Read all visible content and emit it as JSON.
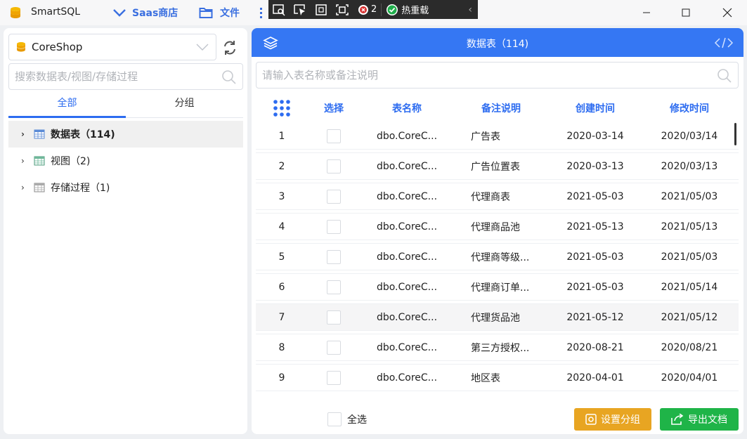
{
  "window": {
    "app_title": "SmartSQL",
    "menu": [
      {
        "label": "Saas商店"
      },
      {
        "label": "文件"
      }
    ]
  },
  "devtools": {
    "error_count": "2",
    "hot_reload_label": "热重载"
  },
  "left": {
    "database": "CoreShop",
    "search_placeholder": "搜索数据表/视图/存储过程",
    "tabs": [
      {
        "label": "全部",
        "active": true
      },
      {
        "label": "分组",
        "active": false
      }
    ],
    "tree": [
      {
        "label": "数据表（114)",
        "icon": "table-icon",
        "selected": true
      },
      {
        "label": "视图（2)",
        "icon": "view-icon",
        "selected": false
      },
      {
        "label": "存储过程（1)",
        "icon": "procedure-icon",
        "selected": false
      }
    ]
  },
  "right": {
    "title": "数据表（114)",
    "search_placeholder": "请输入表名称或备注说明",
    "columns": {
      "select": "选择",
      "name": "表名称",
      "note": "备注说明",
      "created": "创建时间",
      "modified": "修改时间"
    },
    "rows": [
      {
        "idx": "1",
        "name": "dbo.CoreC...",
        "note": "广告表",
        "created": "2020-03-14",
        "modified": "2020/03/14"
      },
      {
        "idx": "2",
        "name": "dbo.CoreC...",
        "note": "广告位置表",
        "created": "2020-03-13",
        "modified": "2020/03/13"
      },
      {
        "idx": "3",
        "name": "dbo.CoreC...",
        "note": "代理商表",
        "created": "2021-05-03",
        "modified": "2021/05/03"
      },
      {
        "idx": "4",
        "name": "dbo.CoreC...",
        "note": "代理商品池",
        "created": "2021-05-13",
        "modified": "2021/05/13"
      },
      {
        "idx": "5",
        "name": "dbo.CoreC...",
        "note": "代理商等级...",
        "created": "2021-05-03",
        "modified": "2021/05/03"
      },
      {
        "idx": "6",
        "name": "dbo.CoreC...",
        "note": "代理商订单...",
        "created": "2021-05-03",
        "modified": "2021/05/14"
      },
      {
        "idx": "7",
        "name": "dbo.CoreC...",
        "note": "代理货品池",
        "created": "2021-05-12",
        "modified": "2021/05/12"
      },
      {
        "idx": "8",
        "name": "dbo.CoreC...",
        "note": "第三方授权...",
        "created": "2020-08-21",
        "modified": "2020/08/21"
      },
      {
        "idx": "9",
        "name": "dbo.CoreC...",
        "note": "地区表",
        "created": "2020-04-01",
        "modified": "2020/04/01"
      }
    ],
    "footer": {
      "select_all": "全选",
      "group_button": "设置分组",
      "export_button": "导出文档"
    }
  },
  "colors": {
    "accent": "#3577f3",
    "warning": "#e8a522",
    "success": "#1fb448"
  }
}
